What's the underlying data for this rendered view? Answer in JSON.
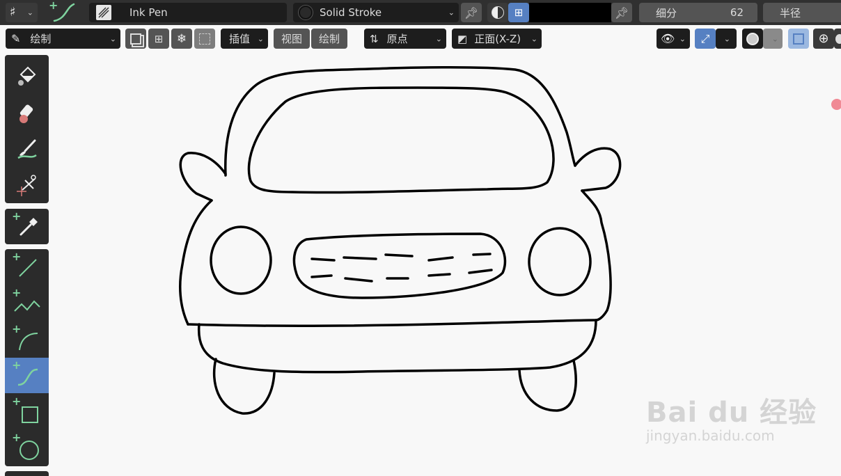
{
  "header": {
    "brush_name": "Ink Pen",
    "material_name": "Solid Stroke",
    "color_hex": "#000000",
    "subdivision_label": "细分",
    "subdivision_value": "62",
    "radius_label": "半径"
  },
  "toolbar": {
    "mode_label": "绘制",
    "interpolate_label": "插值",
    "view_label": "视图",
    "draw_label": "绘制",
    "pivot_label": "原点",
    "orientation_label": "正面(X-Z)"
  },
  "tools": [
    {
      "name": "fill-tool",
      "icon": "paint-bucket-icon"
    },
    {
      "name": "erase-tool",
      "icon": "eraser-icon"
    },
    {
      "name": "tint-tool",
      "icon": "brush-icon"
    },
    {
      "name": "cutter-tool",
      "icon": "scissors-icon"
    },
    {
      "name": "eyedropper-tool",
      "icon": "eyedropper-icon"
    },
    {
      "name": "line-tool",
      "icon": "line-icon"
    },
    {
      "name": "polyline-tool",
      "icon": "polyline-icon"
    },
    {
      "name": "arc-tool",
      "icon": "arc-icon"
    },
    {
      "name": "curve-tool",
      "icon": "curve-icon",
      "active": true
    },
    {
      "name": "box-tool",
      "icon": "box-icon"
    },
    {
      "name": "circle-tool",
      "icon": "circle-icon"
    }
  ],
  "watermark": {
    "brand": "Bai du 经验",
    "url": "jingyan.baidu.com"
  },
  "colors": {
    "accent": "#5680c2",
    "panel": "#303030",
    "plus_green": "#7fd39f",
    "canvas": "#f8f8f8"
  }
}
